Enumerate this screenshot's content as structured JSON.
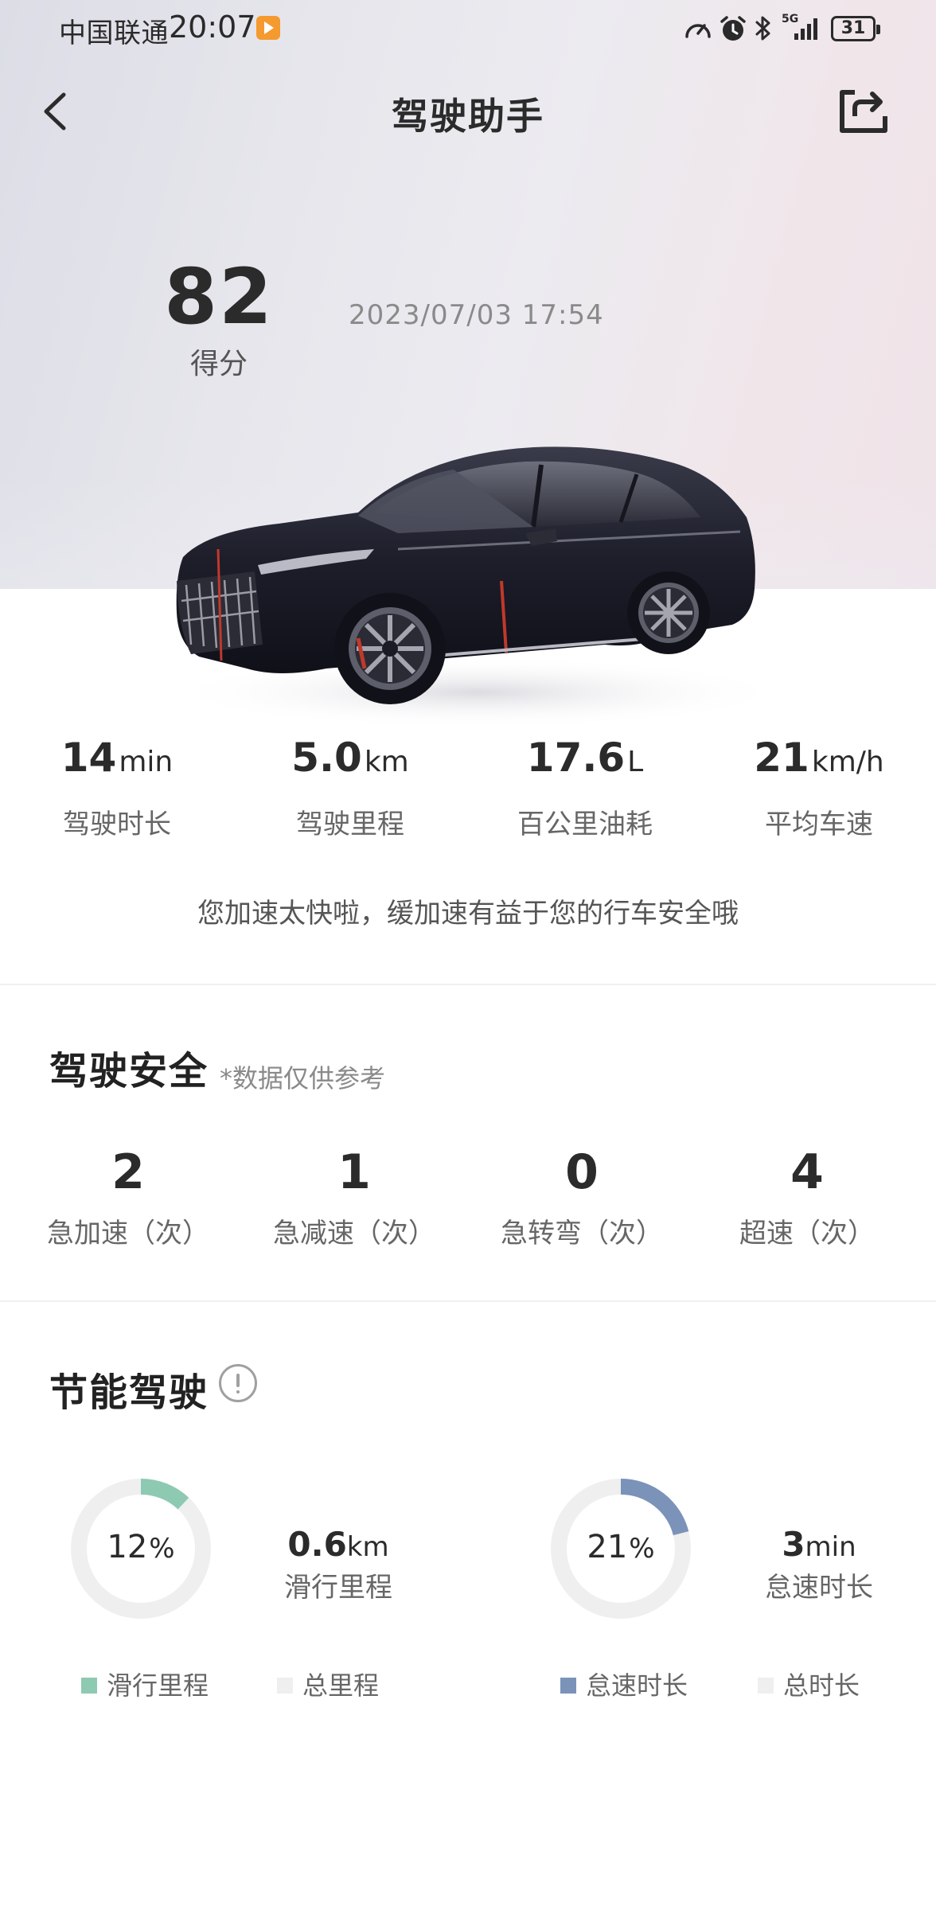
{
  "status_bar": {
    "carrier": "中国联通",
    "time": "20:07",
    "network": "5G",
    "battery": "31",
    "icons": [
      "speed-meter-icon",
      "alarm-icon",
      "bluetooth-icon",
      "signal-icon"
    ]
  },
  "header": {
    "title": "驾驶助手",
    "back_icon": "chevron-left-icon",
    "share_icon": "share-icon"
  },
  "summary": {
    "score": "82",
    "score_label": "得分",
    "datetime": "2023/07/03  17:54"
  },
  "stats": [
    {
      "value": "14",
      "unit": "min",
      "label": "驾驶时长"
    },
    {
      "value": "5.0",
      "unit": "km",
      "label": "驾驶里程"
    },
    {
      "value": "17.6",
      "unit": "L",
      "label": "百公里油耗"
    },
    {
      "value": "21",
      "unit": "km/h",
      "label": "平均车速"
    }
  ],
  "tip": "您加速太快啦，缓加速有益于您的行车安全哦",
  "safety": {
    "title": "驾驶安全",
    "note": "*数据仅供参考",
    "items": [
      {
        "value": "2",
        "label": "急加速（次）"
      },
      {
        "value": "1",
        "label": "急减速（次）"
      },
      {
        "value": "0",
        "label": "急转弯（次）"
      },
      {
        "value": "4",
        "label": "超速（次）"
      }
    ]
  },
  "eco": {
    "title": "节能驾驶",
    "info_icon": "info-icon",
    "coast": {
      "percent": 12,
      "percent_text": "12",
      "pct_sign": "%",
      "value": "0.6",
      "unit": "km",
      "label": "滑行里程",
      "legend_a": "滑行里程",
      "legend_b": "总里程",
      "color": "#8ecab1"
    },
    "idle": {
      "percent": 21,
      "percent_text": "21",
      "pct_sign": "%",
      "value": "3",
      "unit": "min",
      "label": "怠速时长",
      "legend_a": "怠速时长",
      "legend_b": "总时长",
      "color": "#7b93b9"
    },
    "track_color": "#efefef"
  }
}
